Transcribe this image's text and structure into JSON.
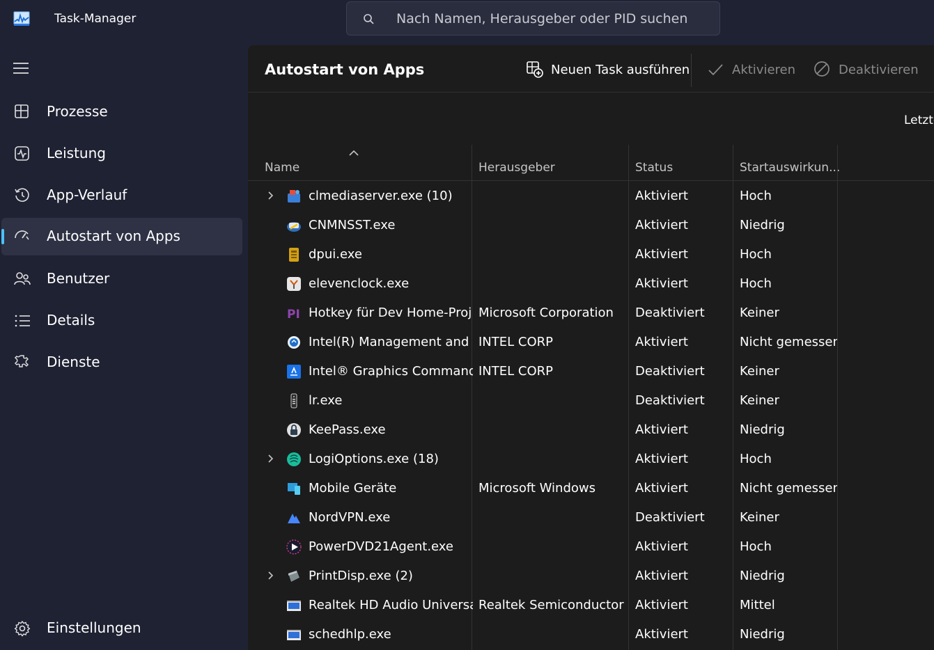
{
  "window": {
    "title": "Task-Manager",
    "search_placeholder": "Nach Namen, Herausgeber oder PID suchen"
  },
  "sidebar": {
    "items": [
      {
        "label": "Prozesse",
        "icon": "processes-icon"
      },
      {
        "label": "Leistung",
        "icon": "performance-icon"
      },
      {
        "label": "App-Verlauf",
        "icon": "history-icon"
      },
      {
        "label": "Autostart von Apps",
        "icon": "startup-apps-icon",
        "active": true
      },
      {
        "label": "Benutzer",
        "icon": "users-icon"
      },
      {
        "label": "Details",
        "icon": "details-list-icon"
      },
      {
        "label": "Dienste",
        "icon": "services-icon"
      }
    ],
    "settings_label": "Einstellungen"
  },
  "main": {
    "page_title": "Autostart von Apps",
    "toolbar": {
      "run_task": "Neuen Task ausführen",
      "enable": "Aktivieren",
      "disable": "Deaktivieren"
    },
    "extra_label": "Letzte",
    "columns": {
      "name": "Name",
      "publisher": "Herausgeber",
      "status": "Status",
      "impact": "Startauswirkun..."
    },
    "rows": [
      {
        "name": "clmediaserver.exe (10)",
        "publisher": "",
        "status": "Aktiviert",
        "impact": "Hoch",
        "expandable": true,
        "icon": "clmediaserver-icon"
      },
      {
        "name": "CNMNSST.exe",
        "publisher": "",
        "status": "Aktiviert",
        "impact": "Niedrig",
        "expandable": false,
        "icon": "cnmnsst-icon"
      },
      {
        "name": "dpui.exe",
        "publisher": "",
        "status": "Aktiviert",
        "impact": "Hoch",
        "expandable": false,
        "icon": "dpui-icon"
      },
      {
        "name": "elevenclock.exe",
        "publisher": "",
        "status": "Aktiviert",
        "impact": "Hoch",
        "expandable": false,
        "icon": "elevenclock-icon"
      },
      {
        "name": "Hotkey für Dev Home-Proj...",
        "publisher": "Microsoft Corporation",
        "status": "Deaktiviert",
        "impact": "Keiner",
        "expandable": false,
        "icon": "powertoys-icon"
      },
      {
        "name": "Intel(R) Management and ...",
        "publisher": "INTEL CORP",
        "status": "Aktiviert",
        "impact": "Nicht gemessen",
        "expandable": false,
        "icon": "intel-management-icon"
      },
      {
        "name": "Intel® Graphics Command...",
        "publisher": "INTEL CORP",
        "status": "Deaktiviert",
        "impact": "Keiner",
        "expandable": false,
        "icon": "intel-graphics-icon"
      },
      {
        "name": "lr.exe",
        "publisher": "",
        "status": "Deaktiviert",
        "impact": "Keiner",
        "expandable": false,
        "icon": "remote-icon"
      },
      {
        "name": "KeePass.exe",
        "publisher": "",
        "status": "Aktiviert",
        "impact": "Niedrig",
        "expandable": false,
        "icon": "keepass-icon"
      },
      {
        "name": "LogiOptions.exe (18)",
        "publisher": "",
        "status": "Aktiviert",
        "impact": "Hoch",
        "expandable": true,
        "icon": "logioptions-icon"
      },
      {
        "name": "Mobile Geräte",
        "publisher": "Microsoft Windows",
        "status": "Aktiviert",
        "impact": "Nicht gemessen",
        "expandable": false,
        "icon": "mobile-devices-icon"
      },
      {
        "name": "NordVPN.exe",
        "publisher": "",
        "status": "Deaktiviert",
        "impact": "Keiner",
        "expandable": false,
        "icon": "nordvpn-icon"
      },
      {
        "name": "PowerDVD21Agent.exe",
        "publisher": "",
        "status": "Aktiviert",
        "impact": "Hoch",
        "expandable": false,
        "icon": "powerdvd-icon"
      },
      {
        "name": "PrintDisp.exe (2)",
        "publisher": "",
        "status": "Aktiviert",
        "impact": "Niedrig",
        "expandable": true,
        "icon": "printdisp-icon"
      },
      {
        "name": "Realtek HD Audio Universa...",
        "publisher": "Realtek Semiconductor",
        "status": "Aktiviert",
        "impact": "Mittel",
        "expandable": false,
        "icon": "realtek-icon"
      },
      {
        "name": "schedhlp.exe",
        "publisher": "",
        "status": "Aktiviert",
        "impact": "Niedrig",
        "expandable": false,
        "icon": "schedhlp-icon"
      }
    ]
  },
  "colors": {
    "sidebar_bg": "#1f2233",
    "main_bg": "#1c1c1c",
    "accent": "#4cc2ff",
    "disabled_text": "#8a8a8a"
  }
}
